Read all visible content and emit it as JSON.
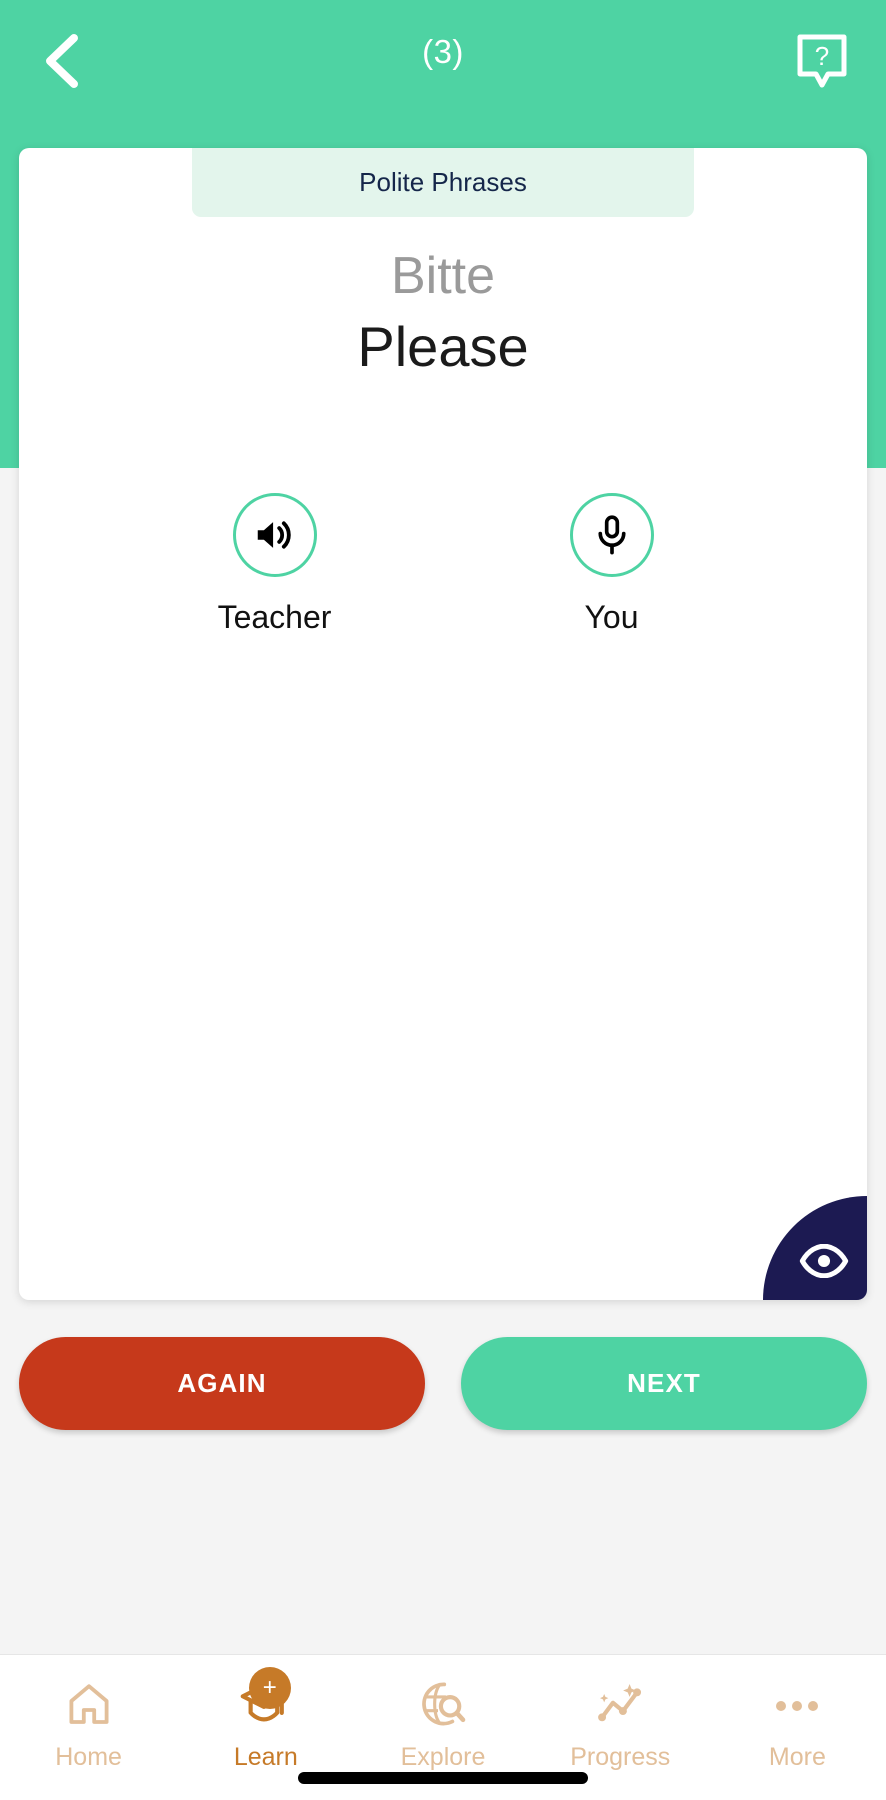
{
  "header": {
    "title": "(3)",
    "back_icon": "chevron-left-icon",
    "help_icon": "help-question-bubble-icon",
    "background_color": "#4ed3a3"
  },
  "card": {
    "category": "Polite Phrases",
    "word_foreign": "Bitte",
    "word_native": "Please",
    "category_background": "#e3f5ec",
    "audio_controls": [
      {
        "label": "Teacher",
        "icon": "speaker-volume-icon",
        "ring_color": "#4ed3a3"
      },
      {
        "label": "You",
        "icon": "microphone-icon",
        "ring_color": "#4ed3a3"
      }
    ],
    "reveal": {
      "icon": "eye-icon",
      "background": "#1c1a52"
    }
  },
  "actions": {
    "again_label": "AGAIN",
    "again_color": "#c6391b",
    "next_label": "NEXT",
    "next_color": "#4ed3a3"
  },
  "bottom_nav": {
    "items": [
      {
        "label": "Home",
        "icon": "home-icon",
        "active": false
      },
      {
        "label": "Learn",
        "icon": "graduation-cap-icon",
        "active": true,
        "badge": "+"
      },
      {
        "label": "Explore",
        "icon": "globe-search-icon",
        "active": false
      },
      {
        "label": "Progress",
        "icon": "progress-chart-icon",
        "active": false
      },
      {
        "label": "More",
        "icon": "ellipsis-icon",
        "active": false
      }
    ],
    "inactive_color": "#e2bf9a",
    "active_color": "#c67a28"
  }
}
